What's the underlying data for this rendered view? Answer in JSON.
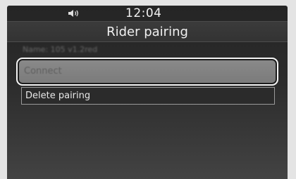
{
  "status_bar": {
    "volume_icon": "speaker-icon",
    "time": "12:04"
  },
  "screen": {
    "title": "Rider pairing",
    "device_info": "Name: 105 v1.2red"
  },
  "menu": {
    "items": [
      {
        "label": "Connect",
        "selected": true,
        "enabled": false
      },
      {
        "label": "Delete pairing",
        "selected": false,
        "enabled": true
      }
    ]
  },
  "colors": {
    "background": "#2c2c2c",
    "selection_frame": "#f4f4f4",
    "selected_fill": "#828282",
    "text": "#f0f0f0",
    "disabled_text": "#5f5f5f"
  }
}
